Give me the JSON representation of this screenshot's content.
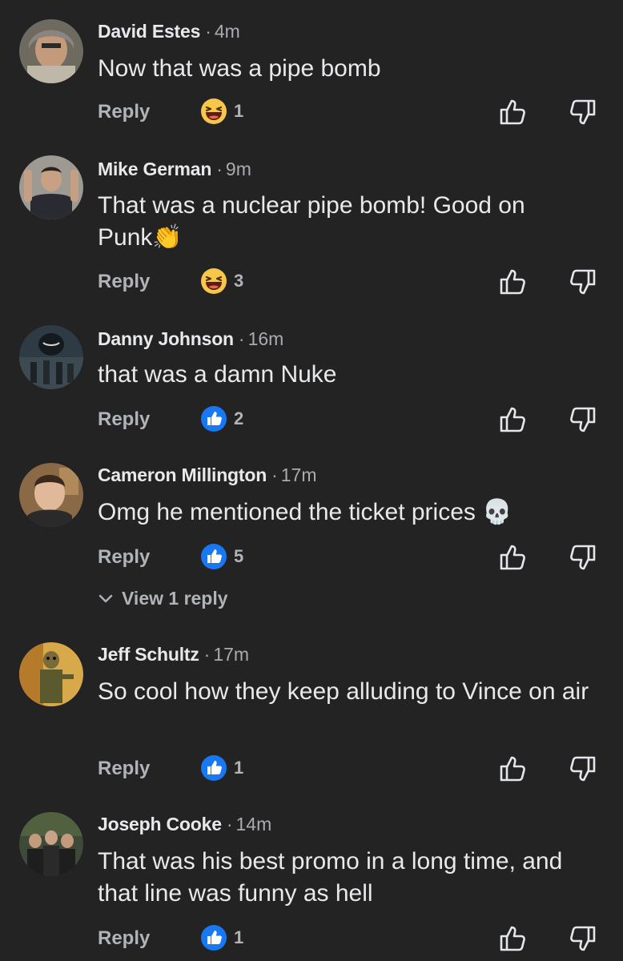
{
  "comments": [
    {
      "name": "David Estes",
      "time": "4m",
      "text": "Now that was a pipe bomb",
      "reply": "Reply",
      "reaction": "laugh",
      "count": "1"
    },
    {
      "name": "Mike German",
      "time": "9m",
      "text": "That was a nuclear pipe bomb! Good on Punk",
      "emoji": "👏",
      "reply": "Reply",
      "reaction": "laugh",
      "count": "3"
    },
    {
      "name": "Danny Johnson",
      "time": "16m",
      "text": "that was a damn Nuke",
      "reply": "Reply",
      "reaction": "like",
      "count": "2"
    },
    {
      "name": "Cameron Millington",
      "time": "17m",
      "text": "Omg he mentioned the ticket prices",
      "emoji": "💀",
      "reply": "Reply",
      "reaction": "like",
      "count": "5",
      "view_replies": "View 1 reply"
    },
    {
      "name": "Jeff Schultz",
      "time": "17m",
      "text": "So cool how they keep alluding to Vince on air",
      "reply": "Reply",
      "reaction": "like",
      "count": "1"
    },
    {
      "name": "Joseph Cooke",
      "time": "14m",
      "text": "That was his best promo in a long time, and that line was funny as hell",
      "reply": "Reply",
      "reaction": "like",
      "count": "1"
    }
  ],
  "separator": "·",
  "colors": {
    "background": "#232324",
    "like_blue": "#1877f2",
    "laugh_yellow": "#f7c64a",
    "muted": "#b0b3b8"
  }
}
